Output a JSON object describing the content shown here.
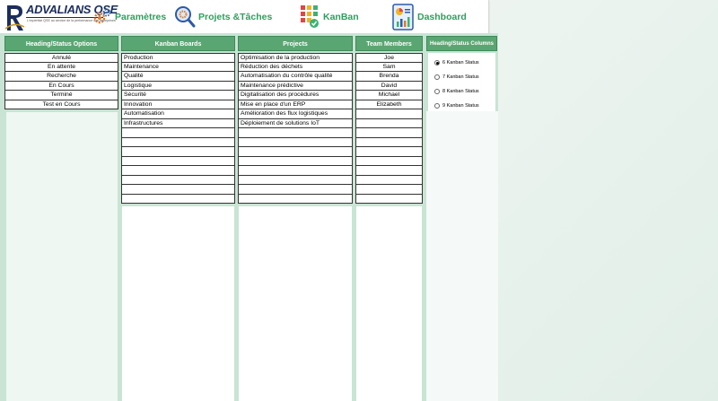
{
  "app": {
    "brand": "ADVALIANS QSE",
    "tagline": "L'expertise QSE au service de la performance des entreprises"
  },
  "nav": {
    "parametres": "Paramètres",
    "projets_taches": "Projets &Tâches",
    "kanban": "KanBan",
    "dashboard": "Dashboard"
  },
  "columns": {
    "heading_status_options": {
      "title": "Heading/Status Options",
      "items": [
        "Annulé",
        "En attente",
        "Recherche",
        "En Cours",
        "Terminé",
        "Test en Cours"
      ]
    },
    "kanban_boards": {
      "title": "Kanban Boards",
      "items": [
        "Production",
        "Maintenance",
        "Qualité",
        "Logistique",
        "Sécurité",
        "Innovation",
        "Automatisation",
        "Infrastructures",
        "",
        "",
        "",
        "",
        "",
        "",
        "",
        "",
        ""
      ]
    },
    "projects": {
      "title": "Projects",
      "items": [
        "Optimisation de la production",
        "Réduction des déchets",
        "Automatisation du contrôle qualité",
        "Maintenance prédictive",
        "Digitalisation des procédures",
        "Mise en place d'un ERP",
        "Amélioration des flux logistiques",
        "Déploiement de solutions IoT",
        "",
        "",
        "",
        "",
        "",
        "",
        "",
        "",
        ""
      ]
    },
    "team_members": {
      "title": "Team Members",
      "items": [
        "Joe",
        "Sam",
        "Brenda",
        "David",
        "Michael",
        "Elizabeth",
        "",
        "",
        "",
        "",
        "",
        "",
        "",
        "",
        "",
        "",
        ""
      ]
    },
    "heading_status_columns": {
      "title": "Heading/Status Columns",
      "options": [
        "6 Kanban Status",
        "7 Kanban Status",
        "8 Kanban Status",
        "9 Kanban Status"
      ],
      "selected": "6 Kanban Status"
    }
  }
}
